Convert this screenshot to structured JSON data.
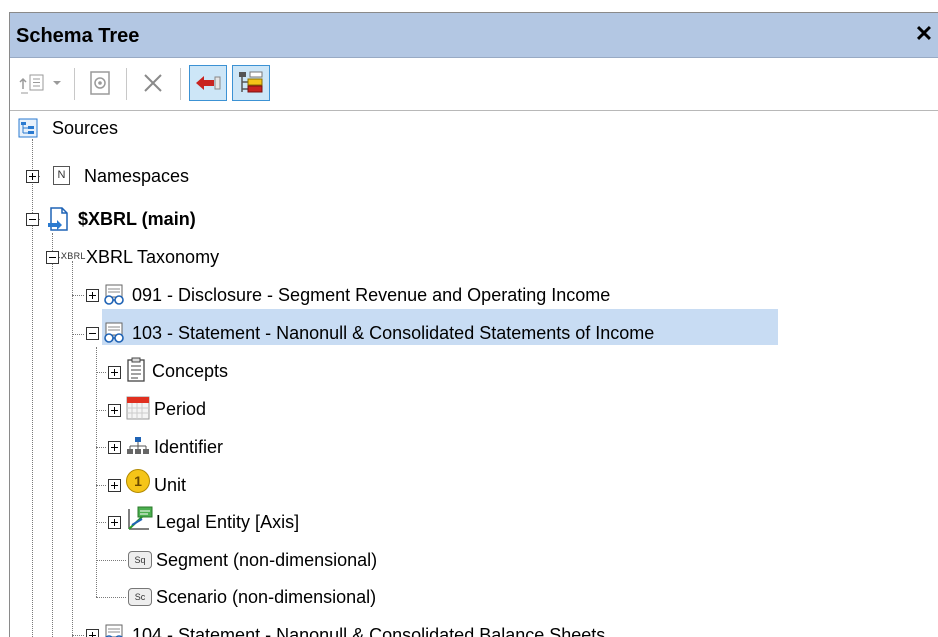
{
  "panel": {
    "title": "Schema Tree",
    "close_glyph": "✕"
  },
  "toolbar": {
    "buttons": [
      {
        "name": "add-root-button",
        "icon": "add-child-icon",
        "enabled": false
      },
      {
        "name": "add-root-dropdown",
        "icon": "chevron-down-icon",
        "enabled": false
      },
      {
        "name": "properties-button",
        "icon": "properties-icon",
        "enabled": false
      },
      {
        "name": "remove-button",
        "icon": "close-icon",
        "enabled": false
      },
      {
        "name": "show-input-button",
        "icon": "arrow-left-icon",
        "pressed": true
      },
      {
        "name": "show-structure-button",
        "icon": "tree-layout-icon",
        "pressed": true
      }
    ]
  },
  "tree": {
    "root": "Sources",
    "namespaces": "Namespaces",
    "xbrl_main": "$XBRL (main)",
    "taxonomy_badge": "XBRL",
    "taxonomy": "XBRL Taxonomy",
    "items": {
      "n091": "091 - Disclosure - Segment Revenue and Operating Income",
      "n103": "103 - Statement - Nanonull & Consolidated Statements of Income",
      "concepts": "Concepts",
      "period": "Period",
      "identifier": "Identifier",
      "unit": "Unit",
      "legal_entity": "Legal Entity [Axis]",
      "segment": "Segment (non-dimensional)",
      "scenario": "Scenario (non-dimensional)",
      "n104": "104 - Statement - Nanonull & Consolidated Balance Sheets"
    },
    "namespace_badge": "N",
    "unit_badge": "1",
    "segment_badge": "Sq",
    "scenario_badge": "Sc",
    "selected": "103 - Statement - Nanonull & Consolidated Statements of Income"
  },
  "colors": {
    "titlebar": "#b3c7e3",
    "selection": "#c8dcf3",
    "accent_blue": "#2a7ad0",
    "arrow_red": "#c8231f"
  }
}
